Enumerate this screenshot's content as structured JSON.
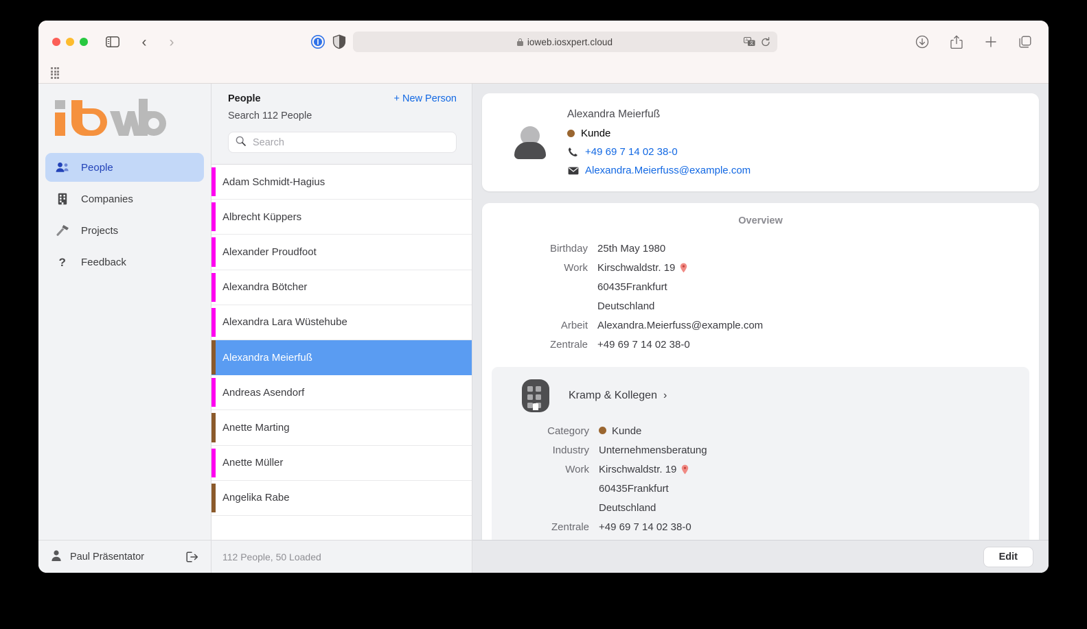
{
  "browser": {
    "url": "ioweb.iosxpert.cloud",
    "icons": {
      "sidebar": "sidebar-toggle-icon",
      "back": "‹",
      "forward": "›",
      "reader": "reader-mode-icon",
      "shield": "privacy-shield-icon",
      "translate": "translate-icon",
      "reload": "reload-icon",
      "download": "download-icon",
      "share": "share-icon",
      "newtab": "+",
      "tabs": "tab-overview-icon"
    }
  },
  "nav": {
    "logo_text": "ioweb",
    "items": [
      {
        "label": "People",
        "icon": "people-icon",
        "active": true
      },
      {
        "label": "Companies",
        "icon": "building-icon",
        "active": false
      },
      {
        "label": "Projects",
        "icon": "hammer-icon",
        "active": false
      },
      {
        "label": "Feedback",
        "icon": "question-mark-icon",
        "active": false
      }
    ],
    "user": "Paul Präsentator",
    "logout_icon": "logout-icon"
  },
  "list": {
    "title": "People",
    "new_person_label": "+ New Person",
    "subtitle": "Search 112 People",
    "search_placeholder": "Search",
    "search_value": "",
    "footer": "112 People, 50 Loaded",
    "colors": {
      "magenta": "#FF00F0",
      "brown": "#8B5A2B",
      "selected_bg": "#5A9CF2"
    },
    "people": [
      {
        "name": "Adam Schmidt-Hagius",
        "color": "#FF00F0",
        "selected": false
      },
      {
        "name": "Albrecht Küppers",
        "color": "#FF00F0",
        "selected": false
      },
      {
        "name": "Alexander Proudfoot",
        "color": "#FF00F0",
        "selected": false
      },
      {
        "name": "Alexandra Bötcher",
        "color": "#FF00F0",
        "selected": false
      },
      {
        "name": "Alexandra Lara Wüstehube",
        "color": "#FF00F0",
        "selected": false
      },
      {
        "name": "Alexandra Meierfuß",
        "color": "#8B5A2B",
        "selected": true
      },
      {
        "name": "Andreas Asendorf",
        "color": "#FF00F0",
        "selected": false
      },
      {
        "name": "Anette Marting",
        "color": "#8B5A2B",
        "selected": false
      },
      {
        "name": "Anette Müller",
        "color": "#FF00F0",
        "selected": false
      },
      {
        "name": "Angelika Rabe",
        "color": "#8B5A2B",
        "selected": false
      }
    ]
  },
  "detail": {
    "person": {
      "name": "Alexandra Meierfuß",
      "category": "Kunde",
      "category_color": "#9A6630",
      "phone": "+49 69 7 14 02 38-0",
      "email": "Alexandra.Meierfuss@example.com"
    },
    "overview": {
      "title": "Overview",
      "fields": [
        {
          "label": "Birthday",
          "value": "25th May 1980",
          "link": false,
          "pin": false
        },
        {
          "label": "Work",
          "value": "Kirschwaldstr. 19",
          "link": false,
          "pin": true
        },
        {
          "label": "",
          "value": "60435Frankfurt",
          "link": false,
          "pin": false
        },
        {
          "label": "",
          "value": "Deutschland",
          "link": false,
          "pin": false
        },
        {
          "label": "Arbeit",
          "value": "Alexandra.Meierfuss@example.com",
          "link": true,
          "pin": false
        },
        {
          "label": "Zentrale",
          "value": "+49 69 7 14 02 38-0",
          "link": true,
          "pin": false
        }
      ]
    },
    "company": {
      "name": "Kramp & Kollegen",
      "chevron": "›",
      "fields": [
        {
          "label": "Category",
          "value": "Kunde",
          "link": false,
          "pin": false,
          "dot": "#9A6630"
        },
        {
          "label": "Industry",
          "value": "Unternehmensberatung",
          "link": false,
          "pin": false
        },
        {
          "label": "Work",
          "value": "Kirschwaldstr. 19",
          "link": false,
          "pin": true
        },
        {
          "label": "",
          "value": "60435Frankfurt",
          "link": false,
          "pin": false
        },
        {
          "label": "",
          "value": "Deutschland",
          "link": false,
          "pin": false
        },
        {
          "label": "Zentrale",
          "value": "+49 69 7 14 02 38-0",
          "link": true,
          "pin": false
        }
      ]
    },
    "edit_label": "Edit"
  }
}
